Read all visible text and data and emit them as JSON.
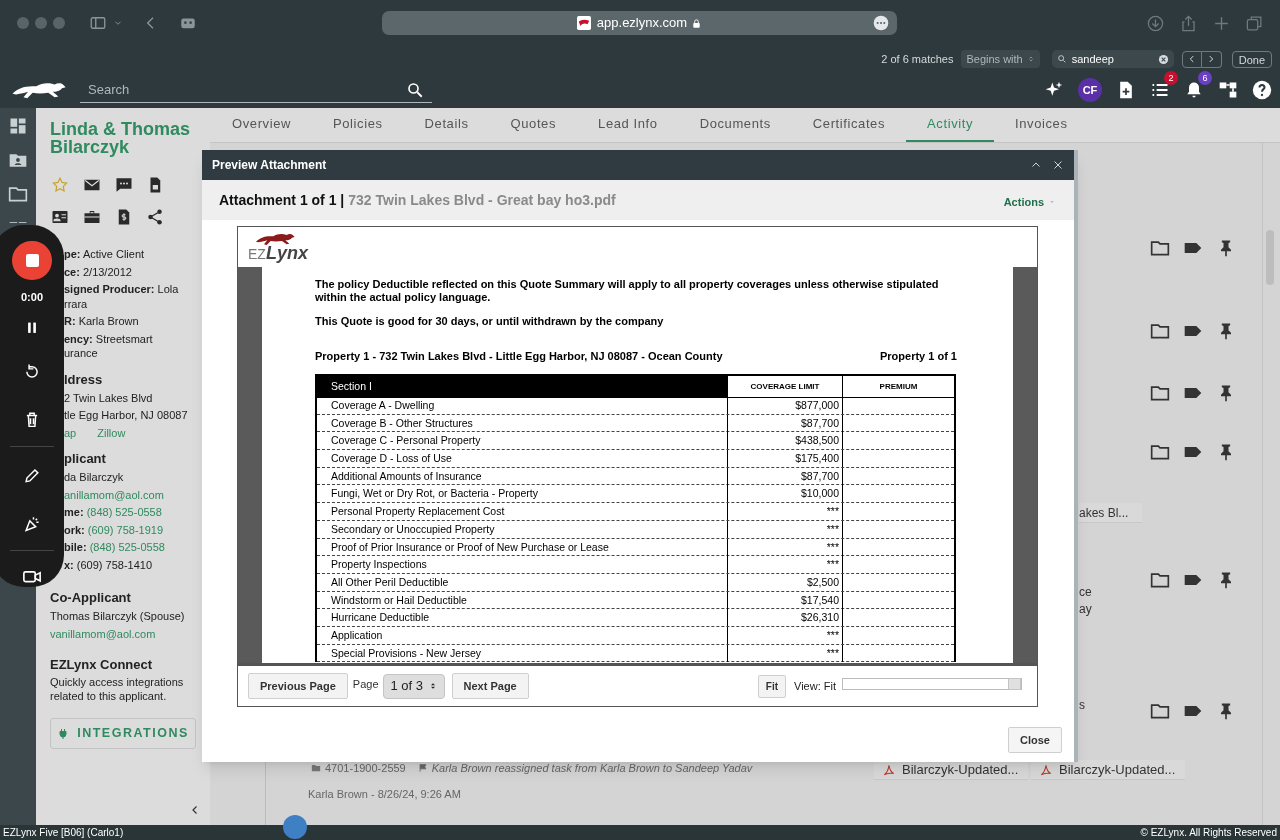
{
  "browser": {
    "url": "app.ezlynx.com",
    "find_bar": {
      "matches": "2 of 6 matches",
      "mode": "Begins with",
      "query": "sandeep",
      "done": "Done"
    }
  },
  "app_header": {
    "search": {
      "placeholder": "Search"
    },
    "avatar": "CF",
    "badges": [
      {
        "kind": "tasks",
        "count": "2",
        "color": "#c8102e"
      },
      {
        "kind": "notifications",
        "count": "6",
        "color": "#6b3fc4"
      }
    ]
  },
  "client": {
    "name": "Linda & Thomas Bilarczyk",
    "details": [
      {
        "kind": "field",
        "label": "pe:",
        "value": "Active Client"
      },
      {
        "kind": "field",
        "label": "ce:",
        "value": "2/13/2012"
      },
      {
        "kind": "field",
        "label": "signed Producer:",
        "value": "Lola"
      },
      {
        "kind": "continuation",
        "text": "rrara"
      },
      {
        "kind": "field",
        "label": "R:",
        "value": "Karla Brown"
      },
      {
        "kind": "field",
        "label": "ency:",
        "value": "Streetsmart"
      },
      {
        "kind": "continuation",
        "text": "urance"
      },
      {
        "kind": "heading",
        "text": "ldress"
      },
      {
        "kind": "text",
        "text": "2 Twin Lakes Blvd"
      },
      {
        "kind": "text",
        "text": "tle Egg Harbor, NJ 08087"
      },
      {
        "kind": "links",
        "links": [
          "ap",
          "Zillow"
        ]
      },
      {
        "kind": "heading",
        "text": "plicant"
      },
      {
        "kind": "text",
        "text": "da Bilarczyk"
      },
      {
        "kind": "link",
        "text": "anillamom@aol.com"
      },
      {
        "kind": "phone",
        "label": "me:",
        "value": "(848) 525-0558"
      },
      {
        "kind": "phone",
        "label": "ork:",
        "value": "(609) 758-1919"
      },
      {
        "kind": "phone",
        "label": "bile:",
        "value": "(848) 525-0558"
      },
      {
        "kind": "field",
        "label": "x:",
        "value": "(609) 758-1410"
      }
    ],
    "co_applicant": {
      "heading": "Co-Applicant",
      "name": "Thomas Bilarczyk (Spouse)",
      "email": "vanillamom@aol.com"
    },
    "connect": {
      "heading": "EZLynx Connect",
      "text": "Quickly access integrations related to this applicant.",
      "button": "INTEGRATIONS"
    }
  },
  "recorder": {
    "time": "0:00"
  },
  "tabs": [
    {
      "label": "Overview",
      "selected": false
    },
    {
      "label": "Policies",
      "selected": false
    },
    {
      "label": "Details",
      "selected": false
    },
    {
      "label": "Quotes",
      "selected": false
    },
    {
      "label": "Lead Info",
      "selected": false
    },
    {
      "label": "Documents",
      "selected": false
    },
    {
      "label": "Certificates",
      "selected": false
    },
    {
      "label": "Activity",
      "selected": true
    },
    {
      "label": "Invoices",
      "selected": false
    }
  ],
  "activity": {
    "fragments": [
      {
        "kind": "chip",
        "text": "akes Bl..."
      },
      {
        "kind": "text",
        "text": "ce"
      },
      {
        "kind": "text",
        "text": "ay"
      },
      {
        "kind": "text",
        "text": "s"
      }
    ],
    "task": {
      "number": "4701-1900-2559",
      "text": "Karla Brown reassigned task from Karla Brown to Sandeep Yadav",
      "byline": "Karla Brown - 8/26/24, 9:26 AM",
      "attachments": [
        "Bilarczyk-Updated...",
        "Bilarczyk-Updated..."
      ]
    }
  },
  "modal": {
    "title": "Preview Attachment",
    "attachment_count": "Attachment 1 of 1 |",
    "file_name": "732 Twin Lakes Blvd - Great bay ho3.pdf",
    "actions": "Actions",
    "document": {
      "logo_prefix": "EZ",
      "logo_name": "Lynx",
      "notes": [
        "The policy Deductible reflected on this Quote Summary will apply to all property coverages unless otherwise stipulated within the actual policy language.",
        "This Quote is good for 30 days, or until withdrawn by the company"
      ],
      "property": "Property 1 - 732 Twin Lakes Blvd - Little Egg Harbor, NJ 08087 - Ocean County",
      "property_count": "Property 1 of 1",
      "table": {
        "columns": [
          "Section I",
          "COVERAGE LIMIT",
          "PREMIUM"
        ],
        "rows": [
          {
            "item": "Coverage A - Dwelling",
            "limit": "$877,000"
          },
          {
            "item": "Coverage B - Other Structures",
            "limit": "$87,700"
          },
          {
            "item": "Coverage C - Personal Property",
            "limit": "$438,500"
          },
          {
            "item": "Coverage D - Loss of Use",
            "limit": "$175,400"
          },
          {
            "item": "Additional Amounts of Insurance",
            "limit": "$87,700"
          },
          {
            "item": "Fungi, Wet or Dry Rot, or Bacteria - Property",
            "limit": "$10,000"
          },
          {
            "item": "Personal Property Replacement Cost",
            "limit": "***"
          },
          {
            "item": "Secondary or Unoccupied Property",
            "limit": "***"
          },
          {
            "item": "Proof of Prior Insurance or Proof of New Purchase or Lease",
            "limit": "***"
          },
          {
            "item": "Property Inspections",
            "limit": "***"
          },
          {
            "item": "All Other Peril Deductible",
            "limit": "$2,500"
          },
          {
            "item": "Windstorm or Hail Deductible",
            "limit": "$17,540"
          },
          {
            "item": "Hurricane Deductible",
            "limit": "$26,310"
          },
          {
            "item": "Application",
            "limit": "***"
          },
          {
            "item": "Special Provisions - New Jersey",
            "limit": "***"
          }
        ]
      }
    },
    "pager": {
      "prev": "Previous Page",
      "page_label": "Page",
      "page": "1 of 3",
      "next": "Next Page",
      "fit": "Fit",
      "view": "View: Fit",
      "zoom": {
        "level": 1
      }
    },
    "close": "Close"
  },
  "status_bar": {
    "left": "EZLynx Five [B06] (Carlo1)",
    "right": "© EZLynx. All Rights Reserved"
  }
}
